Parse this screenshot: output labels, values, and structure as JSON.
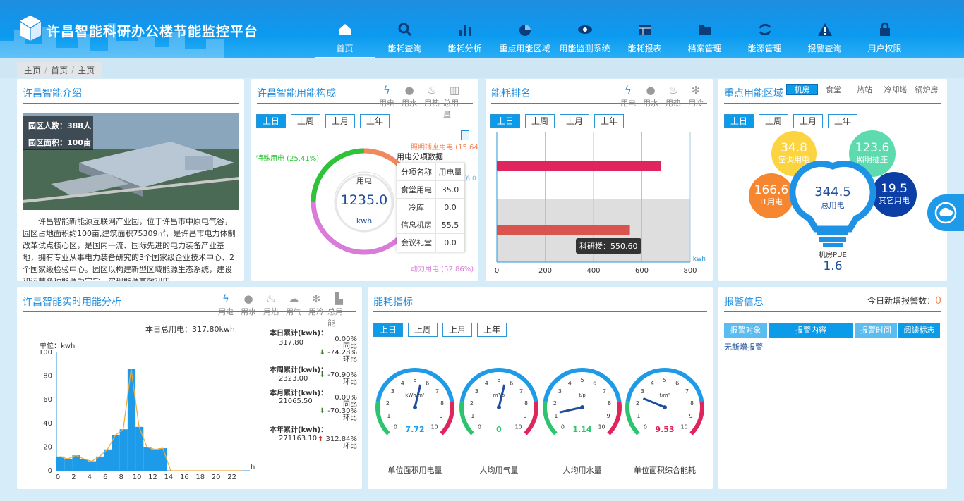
{
  "header": {
    "title": "许昌智能科研办公楼节能监控平台"
  },
  "nav": [
    {
      "label": "首页",
      "icon": "home-icon"
    },
    {
      "label": "能耗查询",
      "icon": "search-icon"
    },
    {
      "label": "能耗分析",
      "icon": "bar-chart-icon"
    },
    {
      "label": "重点用能区域",
      "icon": "pie-icon"
    },
    {
      "label": "用能监测系统",
      "icon": "eye-icon"
    },
    {
      "label": "能耗报表",
      "icon": "table-icon"
    },
    {
      "label": "档案管理",
      "icon": "folder-icon"
    },
    {
      "label": "能源管理",
      "icon": "refresh-icon"
    },
    {
      "label": "报警查询",
      "icon": "warning-icon"
    },
    {
      "label": "用户权限",
      "icon": "lock-icon"
    }
  ],
  "breadcrumb": [
    "主页",
    "首页",
    "主页"
  ],
  "intro": {
    "title": "许昌智能介绍",
    "people": "园区人数：388人",
    "area": "园区面积：100亩",
    "text": "许昌智能新能源互联网产业园，位于许昌市中原电气谷，园区占地面积约100亩,建筑面积75309㎡，是许昌市电力体制改革试点核心区，是国内一流、国际先进的电力装备产业基地，拥有专业从事电力装备研究的3个国家级企业技术中心、2个国家级检验中心。园区以构建新型区域能源生态系统，建设和运营多种能源为宗旨，实现能源高效利用。"
  },
  "period": [
    "上日",
    "上周",
    "上月",
    "上年"
  ],
  "composition": {
    "title": "许昌智能用能构成",
    "icons": [
      {
        "label": "用电",
        "g": "ϟ"
      },
      {
        "label": "用水",
        "g": "●"
      },
      {
        "label": "用热",
        "g": "♨"
      },
      {
        "label": "总用量",
        "g": "▥"
      }
    ],
    "center_label": "用电",
    "center_value": "1235.0",
    "center_unit": "kwh",
    "lbl_lighting": "照明插座用电 (15.64%)",
    "lbl_ac": "空调用电 (6.0",
    "lbl_special": "特殊用电 (25.41%)",
    "lbl_power": "动力用电 (52.86%)",
    "table_title": "用电分项数据",
    "table_head": [
      "分项名称",
      "用电量"
    ],
    "table_rows": [
      [
        "食堂用电",
        "35.0"
      ],
      [
        "冷库",
        "0.0"
      ],
      [
        "信息机房",
        "55.5"
      ],
      [
        "会议礼堂",
        "0.0"
      ]
    ]
  },
  "ranking": {
    "title": "能耗排名",
    "icons": [
      {
        "label": "用电",
        "g": "ϟ"
      },
      {
        "label": "用水",
        "g": "●"
      },
      {
        "label": "用热",
        "g": "♨"
      },
      {
        "label": "用冷",
        "g": "✻"
      }
    ],
    "unit": "kwh",
    "ticks": [
      "0",
      "200",
      "400",
      "600",
      "800"
    ],
    "tooltip": "科研楼：550.60"
  },
  "zone": {
    "title": "重点用能区域",
    "tabs": [
      "机房",
      "食堂",
      "热站",
      "冷却塔",
      "锅炉房"
    ],
    "b1v": "34.8",
    "b1l": "空调用电",
    "b2v": "123.6",
    "b2l": "照明插座",
    "b3v": "166.6",
    "b3l": "IT用电",
    "b4v": "344.5",
    "b4l": "总用电",
    "b5v": "19.5",
    "b5l": "其它用电",
    "pue_label": "机房PUE",
    "pue_value": "1.6"
  },
  "realtime": {
    "title": "许昌智能实时用能分析",
    "icons": [
      {
        "label": "用电",
        "g": "ϟ"
      },
      {
        "label": "用水",
        "g": "●"
      },
      {
        "label": "用热",
        "g": "♨"
      },
      {
        "label": "用气",
        "g": "☁"
      },
      {
        "label": "用冷",
        "g": "✻"
      },
      {
        "label": "总用能",
        "g": "▙"
      }
    ],
    "total": "本日总用电：317.80kwh",
    "unit": "单位：kwh",
    "xlabel": "h",
    "stats": [
      {
        "label": "本日累计(kwh)：",
        "value": "317.80",
        "p1": "0.00%",
        "p1l": "同比",
        "p2": "-74.28%",
        "p2l": "环比"
      },
      {
        "label": "本周累计(kwh)：",
        "value": "2323.00",
        "p2": "-70.90%",
        "p2l": "环比"
      },
      {
        "label": "本月累计(kwh)：",
        "value": "21065.50",
        "p1": "0.00%",
        "p1l": "同比",
        "p2": "-70.30%",
        "p2l": "环比"
      },
      {
        "label": "本年累计(kwh)：",
        "value": "271163.10",
        "p2": "312.84%",
        "p2l": "环比"
      }
    ]
  },
  "indicators": {
    "title": "能耗指标",
    "gauges": [
      {
        "unit": "kWh/m²",
        "value": "7.72",
        "label": "单位面积用电量"
      },
      {
        "unit": "m³/p",
        "value": "0",
        "label": "人均用气量"
      },
      {
        "unit": "t/p",
        "value": "1.14",
        "label": "人均用水量"
      },
      {
        "unit": "t/m²",
        "value": "9.53",
        "label": "单位面积综合能耗"
      }
    ]
  },
  "alarm": {
    "title": "报警信息",
    "today_label": "今日新增报警数：",
    "today_count": "0",
    "cols": [
      "报警对象",
      "报警内容",
      "报警时间",
      "阅读标志"
    ],
    "empty": "无新增报警"
  },
  "chart_data": [
    {
      "type": "bar",
      "title": "能耗排名",
      "orientation": "horizontal",
      "values": [
        680,
        550.6
      ],
      "xlim": [
        0,
        800
      ],
      "unit": "kwh",
      "colors": [
        "#e0245e",
        "#d9534f"
      ]
    },
    {
      "type": "area",
      "title": "许昌智能实时用能分析",
      "x": [
        0,
        1,
        2,
        3,
        4,
        5,
        6,
        7,
        8,
        9,
        10,
        11,
        12,
        13,
        14,
        15,
        16,
        17,
        18,
        19,
        20,
        21,
        22,
        23
      ],
      "values": [
        12,
        10,
        13,
        10,
        8,
        12,
        18,
        30,
        35,
        86,
        37,
        20,
        18,
        19,
        0,
        0,
        0,
        0,
        0,
        0,
        0,
        0,
        0,
        0
      ],
      "ylim": [
        0,
        100
      ],
      "xticks": [
        "0",
        "2",
        "4",
        "6",
        "8",
        "10",
        "12",
        "14",
        "16",
        "18",
        "20",
        "22"
      ],
      "yticks": [
        "0",
        "20",
        "40",
        "60",
        "80",
        "100"
      ]
    }
  ]
}
